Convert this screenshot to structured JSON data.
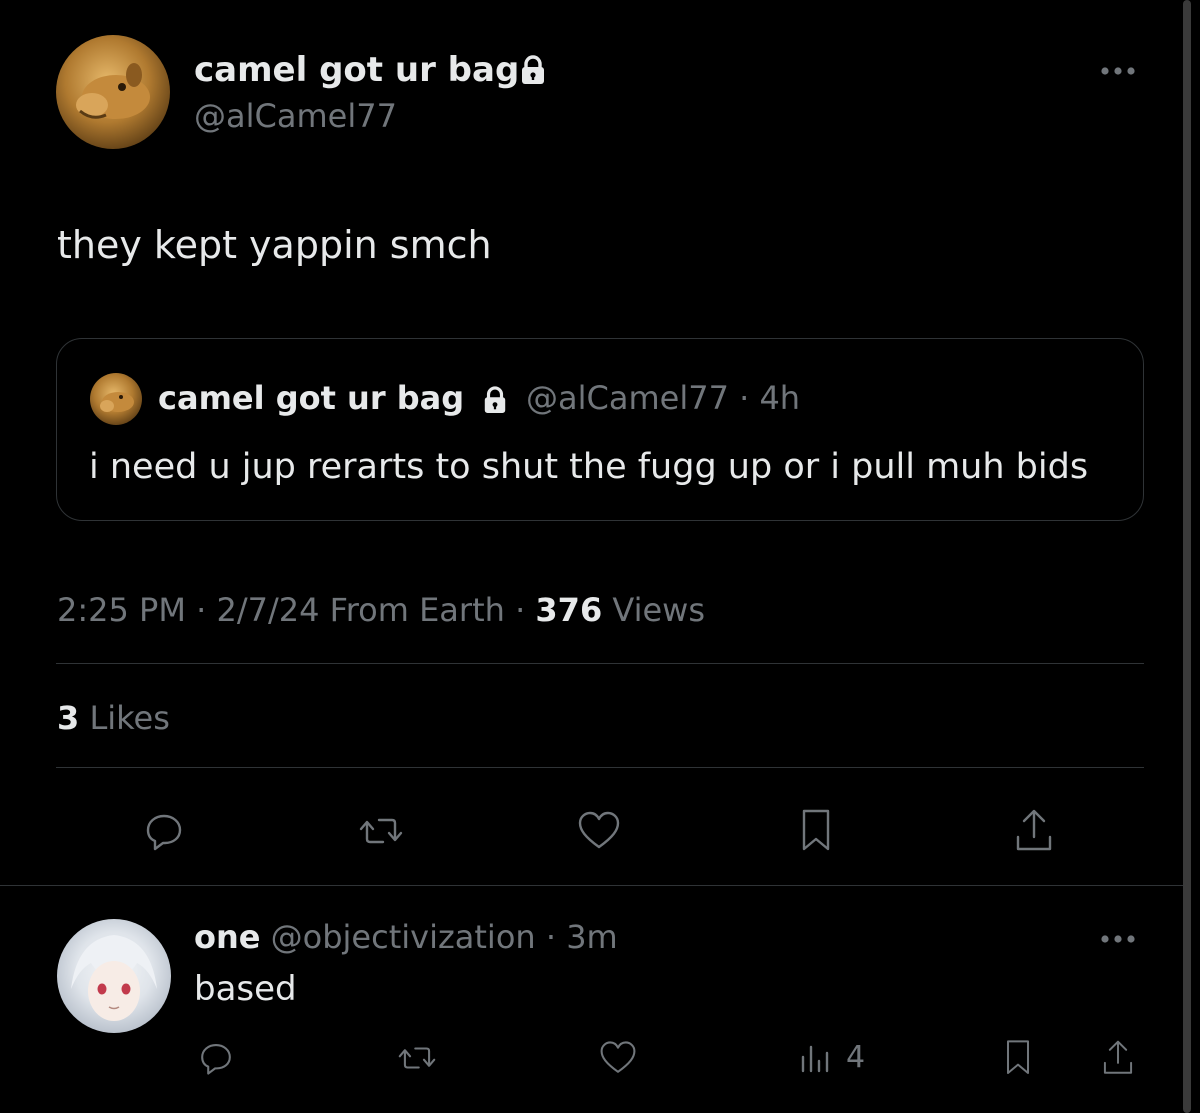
{
  "main_tweet": {
    "author": {
      "display_name": "camel got ur bag",
      "handle": "@alCamel77",
      "avatar_icon": "camel-avatar",
      "protected_icon": "lock-icon"
    },
    "text": "they kept yappin smch",
    "more_icon": "more-icon",
    "quoted_tweet": {
      "display_name": "camel got ur bag",
      "handle": "@alCamel77",
      "dot": "·",
      "time": "4h",
      "text": "i need u jup rerarts to shut the fugg up or i pull muh bids"
    },
    "meta": {
      "time": "2:25 PM",
      "dot1": "·",
      "date": "2/7/24",
      "source": "From Earth",
      "dot2": "·",
      "views_count": "376",
      "views_label": "Views"
    },
    "likes": {
      "count": "3",
      "label": "Likes"
    },
    "actions": [
      "reply-icon",
      "retweet-icon",
      "like-icon",
      "bookmark-icon",
      "share-icon"
    ]
  },
  "reply": {
    "display_name": "one",
    "handle": "@objectivization",
    "dot": "·",
    "time": "3m",
    "text": "based",
    "views": "4",
    "avatar_icon": "anime-avatar",
    "actions": [
      "reply-icon",
      "retweet-icon",
      "like-icon",
      "views-icon",
      "bookmark-icon",
      "share-icon"
    ]
  },
  "colors": {
    "background": "#000000",
    "text": "#e7e9ea",
    "muted": "#71767b",
    "divider": "#2f3336"
  }
}
